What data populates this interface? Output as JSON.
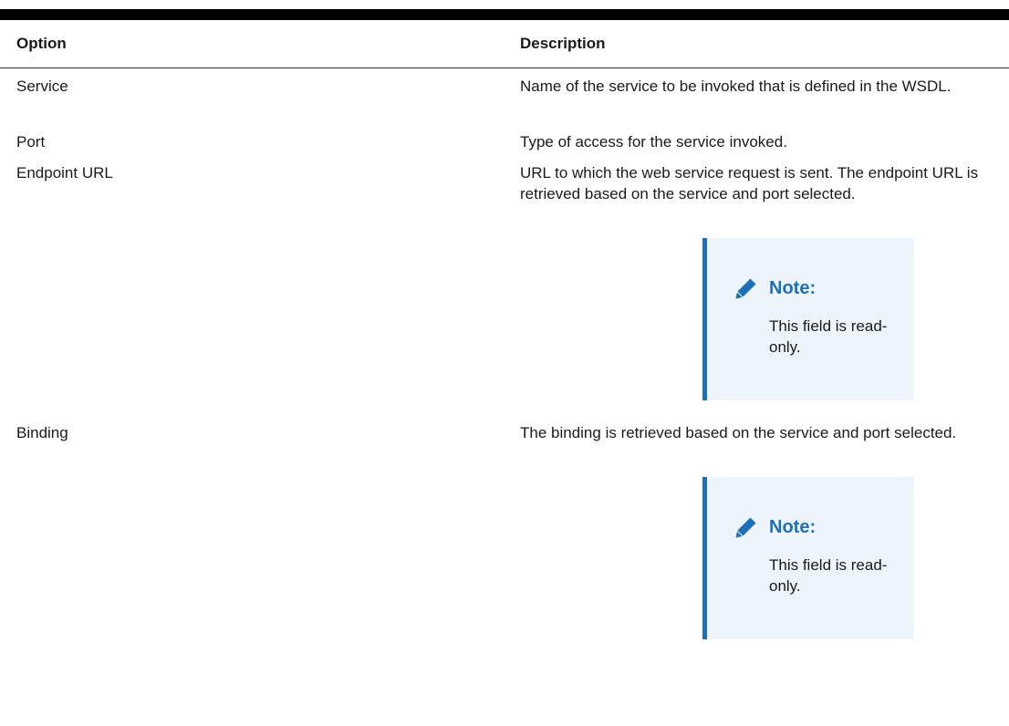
{
  "table": {
    "headers": {
      "option": "Option",
      "description": "Description"
    },
    "rows": [
      {
        "option": "Service",
        "description": "Name of the service to be invoked that is defined in the WSDL."
      },
      {
        "option": "Port",
        "description": "Type of access for the service invoked."
      },
      {
        "option": "Endpoint URL",
        "description": "URL to which the web service request is sent. The endpoint URL is retrieved based on the service and port selected.",
        "note": {
          "icon": "pencil-icon",
          "title": "Note:",
          "text": "This field is read-only."
        }
      },
      {
        "option": "Binding",
        "description": "The binding is retrieved based on the service and port selected.",
        "note": {
          "icon": "pencil-icon",
          "title": "Note:",
          "text": "This field is read-only."
        }
      }
    ]
  },
  "colors": {
    "note_accent": "#1d6fb8",
    "note_background": "#eef4fb",
    "rule": "#000000"
  }
}
